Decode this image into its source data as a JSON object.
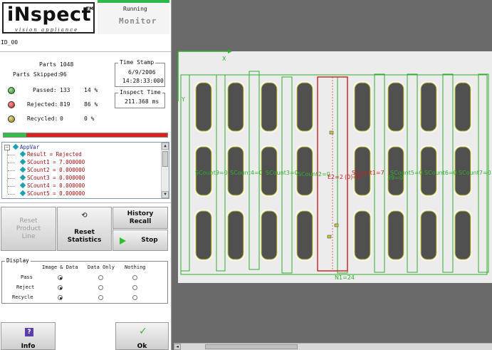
{
  "header": {
    "brand": "iNspect",
    "tm": "TM",
    "tagline": "vision appliance",
    "status": "Running",
    "mode": "Monitor"
  },
  "device_id": "ID_00",
  "stats": {
    "parts_label": "Parts",
    "parts_value": "1048",
    "skipped_label": "Parts Skipped:",
    "skipped_value": "96",
    "passed_label": "Passed:",
    "passed_value": "133",
    "passed_pct": "14 %",
    "rejected_label": "Rejected:",
    "rejected_value": "819",
    "rejected_pct": "86 %",
    "recycled_label": "Recycled:",
    "recycled_value": "0",
    "recycled_pct": "0 %",
    "pass_fraction": 0.14
  },
  "timestamp": {
    "title": "Time Stamp",
    "date": "6/9/2006",
    "time": "14:28:33:000"
  },
  "inspect_time": {
    "title": "Inspect Time",
    "value": "211.368 ms"
  },
  "tree": {
    "root": "AppVar",
    "items": [
      "Result = Rejected",
      "SCount1 = 7.000000",
      "SCount2 = 0.000000",
      "SCount3 = 0.000000",
      "SCount4 = 0.000000",
      "SCount5 = 0.000000"
    ]
  },
  "buttons": {
    "reset_line_1": "Reset",
    "reset_line_2": "Product",
    "reset_line_3": "Line",
    "reset_stats_1": "Reset",
    "reset_stats_2": "Statistics",
    "history_1": "History",
    "history_2": "Recall",
    "stop": "Stop",
    "info": "Info",
    "ok": "Ok"
  },
  "display": {
    "title": "Display",
    "col_image": "Image & Data",
    "col_data": "Data Only",
    "col_nothing": "Nothing",
    "row_pass": "Pass",
    "row_reject": "Reject",
    "row_recycle": "Recycle"
  },
  "overlay": {
    "x_axis": "X",
    "y_axis": "Y",
    "labels": [
      "SCount9=0",
      "SCount4=0",
      "SCount3=0",
      "SCount2=0",
      "E2=2",
      "(0)=0",
      "SCount1=7",
      "SCount5=0",
      "SCount6=0",
      "SCount7=0",
      "39=0"
    ],
    "bottom_label": "N1=24",
    "colors": {
      "pass": "#2fae2f",
      "reject": "#c82020",
      "blob": "#c8c83a"
    }
  }
}
